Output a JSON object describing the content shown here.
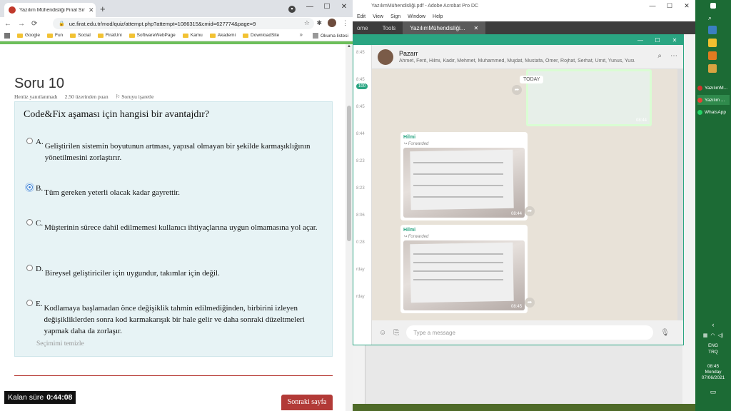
{
  "acrobat": {
    "title": "YazılımMühendisliği.pdf - Adobe Acrobat Pro DC",
    "menu": [
      "Edit",
      "View",
      "Sign",
      "Window",
      "Help"
    ],
    "tabs": [
      "ome",
      "Tools",
      "YazılımMühendisliği..."
    ],
    "side_times": [
      "8:45",
      "8:45",
      "8:45",
      "8:44",
      "8:23",
      "8:23",
      "8:06",
      "0:28",
      "rday",
      "rday"
    ],
    "side_badge": "100"
  },
  "whatsapp": {
    "chat_title": "Pazarr",
    "participants": "Ahmet, Ferit, Hilmi, Kadir, Mehmet, Muhammed, Mujdat, Mustafa, Ömer, Rojhat, Serhat, Ümit, Yunus, Yusuf, ...",
    "today_label": "TODAY",
    "prev_time": "08:44",
    "messages": [
      {
        "sender": "Hilmi",
        "forwarded": "Forwarded",
        "time": "08:44"
      },
      {
        "sender": "Hilmi",
        "forwarded": "Forwarded",
        "time": "08:45"
      }
    ],
    "input_placeholder": "Type a message"
  },
  "chrome": {
    "tab_title": "Yazılım Mühendisliği Final Sınavı",
    "url": "ue.firat.edu.tr/mod/quiz/attempt.php?attempt=1086315&cmid=627774&page=9",
    "bookmarks": [
      "Google",
      "Fun",
      "Social",
      "FiratUni",
      "SoftwareWebPage",
      "Kamu",
      "Akademi",
      "DownloadSite"
    ],
    "reading_list": "Okuma listesi"
  },
  "quiz": {
    "question_title": "Soru 10",
    "status": "Henüz yanıtlanmadı",
    "points": "2.50 üzerinden puan",
    "flag": "Soruyu işaretle",
    "question_text": "Code&Fix aşaması için hangisi bir avantajdır?",
    "options": [
      {
        "letter": "A.",
        "text": "Geliştirilen sistemin boyutunun artması, yapısal olmayan bir şekilde karmaşıklığının yönetilmesini zorlaştırır.",
        "selected": false
      },
      {
        "letter": "B.",
        "text": "Tüm gereken yeterli olacak kadar gayrettir.",
        "selected": true
      },
      {
        "letter": "C.",
        "text": "Müşterinin sürece dahil edilmemesi kullanıcı ihtiyaçlarına uygun olmamasına yol açar.",
        "selected": false
      },
      {
        "letter": "D.",
        "text": "Bireysel geliştiriciler için uygundur, takımlar için değil.",
        "selected": false
      },
      {
        "letter": "E.",
        "text": "Kodlamaya başlamadan önce değişiklik tahmin edilmediğinden, birbirini izleyen değişikliklerden sonra kod karmakarışık bir hale gelir ve daha sonraki düzeltmeleri yapmak daha da zorlaşır.",
        "selected": false
      }
    ],
    "clear_choice": "Seçimimi temizle",
    "next_button": "Sonraki sayfa",
    "timer_label": "Kalan süre",
    "timer_value": "0:44:08"
  },
  "taskbar": {
    "apps": [
      "YazılımM...",
      "Yazılım ...",
      "WhatsApp"
    ],
    "lang1": "ENG",
    "lang2": "TRQ",
    "time": "08:45",
    "day": "Monday",
    "date": "07/06/2021"
  }
}
